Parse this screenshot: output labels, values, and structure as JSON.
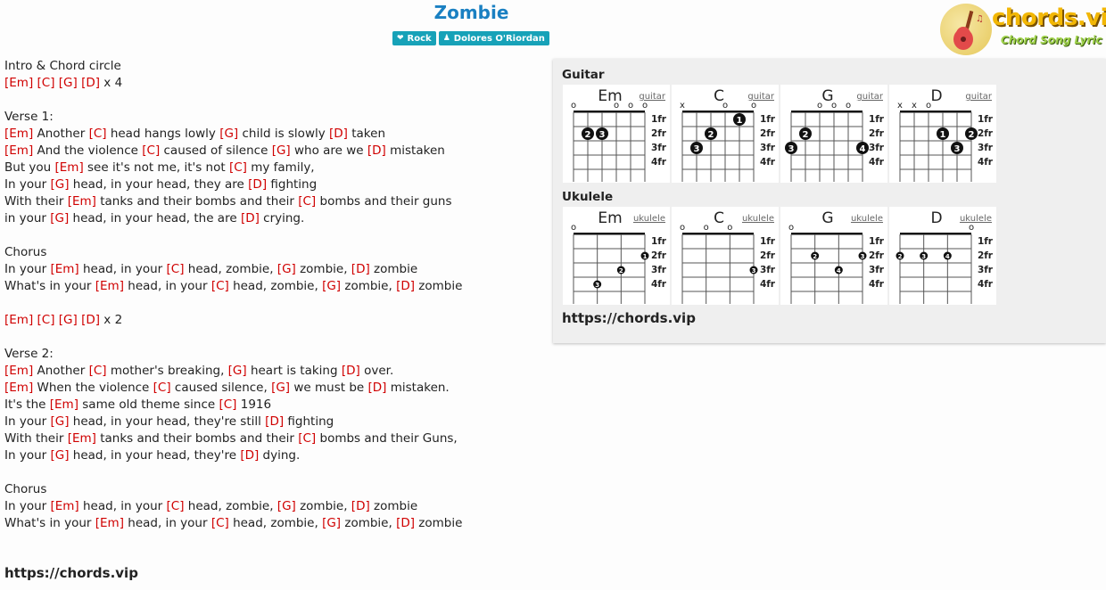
{
  "song": {
    "title": "Zombie",
    "tags": [
      {
        "icon": "heart-icon",
        "label": "Rock"
      },
      {
        "icon": "person-icon",
        "label": "Dolores O'Riordan"
      }
    ]
  },
  "logo": {
    "text": "chords.vip",
    "subtitle": "Chord Song Lyric"
  },
  "lyrics": [
    [
      {
        "t": "Intro & Chord circle"
      }
    ],
    [
      {
        "c": "[Em]"
      },
      {
        "t": " "
      },
      {
        "c": "[C]"
      },
      {
        "t": " "
      },
      {
        "c": "[G]"
      },
      {
        "t": " "
      },
      {
        "c": "[D]"
      },
      {
        "t": " x 4"
      }
    ],
    [],
    [
      {
        "t": "Verse 1:"
      }
    ],
    [
      {
        "c": "[Em]"
      },
      {
        "t": " Another "
      },
      {
        "c": "[C]"
      },
      {
        "t": " head hangs lowly "
      },
      {
        "c": "[G]"
      },
      {
        "t": " child is slowly "
      },
      {
        "c": "[D]"
      },
      {
        "t": " taken"
      }
    ],
    [
      {
        "c": "[Em]"
      },
      {
        "t": " And the violence "
      },
      {
        "c": "[C]"
      },
      {
        "t": " caused of silence "
      },
      {
        "c": "[G]"
      },
      {
        "t": " who are we "
      },
      {
        "c": "[D]"
      },
      {
        "t": " mistaken"
      }
    ],
    [
      {
        "t": "But you "
      },
      {
        "c": "[Em]"
      },
      {
        "t": " see it's not me, it's not "
      },
      {
        "c": "[C]"
      },
      {
        "t": " my family,"
      }
    ],
    [
      {
        "t": "In your "
      },
      {
        "c": "[G]"
      },
      {
        "t": " head, in your head, they are "
      },
      {
        "c": "[D]"
      },
      {
        "t": " fighting"
      }
    ],
    [
      {
        "t": "With their "
      },
      {
        "c": "[Em]"
      },
      {
        "t": " tanks and their bombs and their "
      },
      {
        "c": "[C]"
      },
      {
        "t": " bombs and their guns"
      }
    ],
    [
      {
        "t": "in your "
      },
      {
        "c": "[G]"
      },
      {
        "t": " head, in your head, the are "
      },
      {
        "c": "[D]"
      },
      {
        "t": " crying."
      }
    ],
    [],
    [
      {
        "t": "Chorus"
      }
    ],
    [
      {
        "t": "In your "
      },
      {
        "c": "[Em]"
      },
      {
        "t": " head, in your "
      },
      {
        "c": "[C]"
      },
      {
        "t": " head, zombie, "
      },
      {
        "c": "[G]"
      },
      {
        "t": " zombie, "
      },
      {
        "c": "[D]"
      },
      {
        "t": " zombie"
      }
    ],
    [
      {
        "t": "What's in your "
      },
      {
        "c": "[Em]"
      },
      {
        "t": " head, in your "
      },
      {
        "c": "[C]"
      },
      {
        "t": " head, zombie, "
      },
      {
        "c": "[G]"
      },
      {
        "t": " zombie, "
      },
      {
        "c": "[D]"
      },
      {
        "t": " zombie"
      }
    ],
    [],
    [
      {
        "c": "[Em]"
      },
      {
        "t": " "
      },
      {
        "c": "[C]"
      },
      {
        "t": " "
      },
      {
        "c": "[G]"
      },
      {
        "t": " "
      },
      {
        "c": "[D]"
      },
      {
        "t": " x 2"
      }
    ],
    [],
    [
      {
        "t": "Verse 2:"
      }
    ],
    [
      {
        "c": "[Em]"
      },
      {
        "t": " Another "
      },
      {
        "c": "[C]"
      },
      {
        "t": " mother's breaking, "
      },
      {
        "c": "[G]"
      },
      {
        "t": " heart is taking "
      },
      {
        "c": "[D]"
      },
      {
        "t": " over."
      }
    ],
    [
      {
        "c": "[Em]"
      },
      {
        "t": " When the violence "
      },
      {
        "c": "[C]"
      },
      {
        "t": " caused silence, "
      },
      {
        "c": "[G]"
      },
      {
        "t": " we must be "
      },
      {
        "c": "[D]"
      },
      {
        "t": " mistaken."
      }
    ],
    [
      {
        "t": "It's the "
      },
      {
        "c": "[Em]"
      },
      {
        "t": " same old theme since "
      },
      {
        "c": "[C]"
      },
      {
        "t": " 1916"
      }
    ],
    [
      {
        "t": "In your "
      },
      {
        "c": "[G]"
      },
      {
        "t": " head, in your head, they're still "
      },
      {
        "c": "[D]"
      },
      {
        "t": " fighting"
      }
    ],
    [
      {
        "t": "With their "
      },
      {
        "c": "[Em]"
      },
      {
        "t": " tanks and their bombs and their "
      },
      {
        "c": "[C]"
      },
      {
        "t": " bombs and their Guns,"
      }
    ],
    [
      {
        "t": "In your "
      },
      {
        "c": "[G]"
      },
      {
        "t": " head, in your head, they're "
      },
      {
        "c": "[D]"
      },
      {
        "t": " dying."
      }
    ],
    [],
    [
      {
        "t": "Chorus"
      }
    ],
    [
      {
        "t": "In your "
      },
      {
        "c": "[Em]"
      },
      {
        "t": " head, in your "
      },
      {
        "c": "[C]"
      },
      {
        "t": " head, zombie, "
      },
      {
        "c": "[G]"
      },
      {
        "t": " zombie, "
      },
      {
        "c": "[D]"
      },
      {
        "t": " zombie"
      }
    ],
    [
      {
        "t": "What's in your "
      },
      {
        "c": "[Em]"
      },
      {
        "t": " head, in your "
      },
      {
        "c": "[C]"
      },
      {
        "t": " head, zombie, "
      },
      {
        "c": "[G]"
      },
      {
        "t": " zombie, "
      },
      {
        "c": "[D]"
      },
      {
        "t": " zombie"
      }
    ]
  ],
  "footer": {
    "link": "https://chords.vip"
  },
  "panel": {
    "link": "https://chords.vip",
    "fret_labels": [
      "1fr",
      "2fr",
      "3fr",
      "4fr"
    ],
    "guitar": {
      "heading": "Guitar",
      "link_label": "guitar",
      "strings": 6,
      "chords": [
        {
          "name": "Em",
          "markers": [
            "o",
            "",
            "",
            "o",
            "o",
            "o"
          ],
          "dots": [
            {
              "string": 2,
              "fret": 2,
              "finger": "2"
            },
            {
              "string": 3,
              "fret": 2,
              "finger": "3"
            }
          ]
        },
        {
          "name": "C",
          "markers": [
            "x",
            "",
            "",
            "o",
            "",
            "o"
          ],
          "dots": [
            {
              "string": 2,
              "fret": 3,
              "finger": "3"
            },
            {
              "string": 3,
              "fret": 2,
              "finger": "2"
            },
            {
              "string": 5,
              "fret": 1,
              "finger": "1"
            }
          ]
        },
        {
          "name": "G",
          "markers": [
            "",
            "",
            "o",
            "o",
            "o",
            ""
          ],
          "dots": [
            {
              "string": 1,
              "fret": 3,
              "finger": "3"
            },
            {
              "string": 2,
              "fret": 2,
              "finger": "2"
            },
            {
              "string": 6,
              "fret": 3,
              "finger": "4"
            }
          ]
        },
        {
          "name": "D",
          "markers": [
            "x",
            "x",
            "o",
            "",
            "",
            ""
          ],
          "dots": [
            {
              "string": 4,
              "fret": 2,
              "finger": "1"
            },
            {
              "string": 5,
              "fret": 3,
              "finger": "3"
            },
            {
              "string": 6,
              "fret": 2,
              "finger": "2"
            }
          ]
        }
      ]
    },
    "ukulele": {
      "heading": "Ukulele",
      "link_label": "ukulele",
      "strings": 4,
      "chords": [
        {
          "name": "Em",
          "markers": [
            "o",
            "",
            "",
            ""
          ],
          "dots": [
            {
              "string": 2,
              "fret": 4,
              "finger": "3"
            },
            {
              "string": 3,
              "fret": 3,
              "finger": "2"
            },
            {
              "string": 4,
              "fret": 2,
              "finger": "1"
            }
          ]
        },
        {
          "name": "C",
          "markers": [
            "o",
            "o",
            "o",
            ""
          ],
          "dots": [
            {
              "string": 4,
              "fret": 3,
              "finger": "3"
            }
          ]
        },
        {
          "name": "G",
          "markers": [
            "o",
            "",
            "",
            ""
          ],
          "dots": [
            {
              "string": 2,
              "fret": 2,
              "finger": "2"
            },
            {
              "string": 3,
              "fret": 3,
              "finger": "4"
            },
            {
              "string": 4,
              "fret": 2,
              "finger": "3"
            }
          ]
        },
        {
          "name": "D",
          "markers": [
            "",
            "",
            "",
            "o"
          ],
          "dots": [
            {
              "string": 1,
              "fret": 2,
              "finger": "2"
            },
            {
              "string": 2,
              "fret": 2,
              "finger": "3"
            },
            {
              "string": 3,
              "fret": 2,
              "finger": "4"
            }
          ]
        }
      ]
    }
  }
}
